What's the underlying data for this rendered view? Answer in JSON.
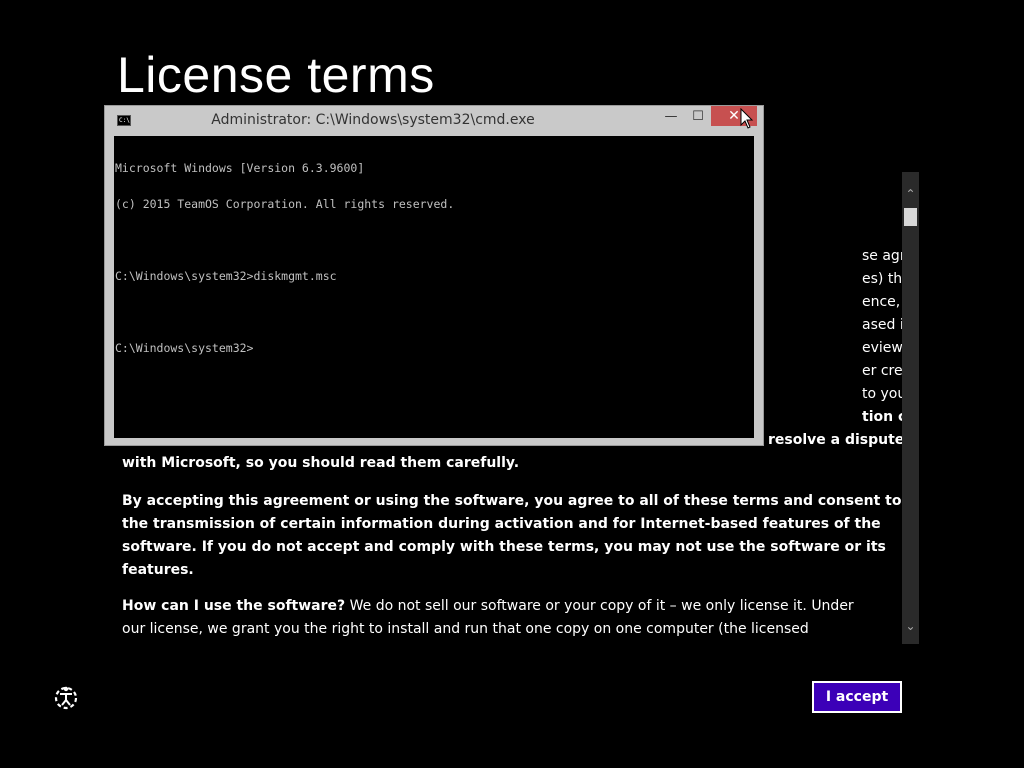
{
  "page": {
    "title": "License terms"
  },
  "license": {
    "partial_lines": [
      "se agreement",
      "es) that describes",
      "ence, we’ve",
      "ased in a question",
      "eview the entire",
      "er create this",
      "to your browser",
      "tion clause and",
      "resolve a dispute"
    ],
    "line_with_microsoft": "with Microsoft, so you should read them carefully.",
    "paragraph_accept": [
      "By accepting this agreement or using the software, you agree to all of these terms and consent to",
      "the transmission of certain information during activation and for Internet-based features of the",
      "software. If you do not accept and comply with these terms, you may not use the software or its",
      "features."
    ],
    "paragraph_use_heading": "How can I use the software?",
    "paragraph_use_line1_rest": " We do not sell our software or your copy of it – we only license it. Under",
    "paragraph_use_line2": "our license, we grant you the right to install and run that one copy on one computer (the licensed"
  },
  "scrollbar": {
    "up_glyph": "⌃",
    "down_glyph": "⌄"
  },
  "accept_button": {
    "label": "I accept"
  },
  "cmd": {
    "title": "Administrator: C:\\Windows\\system32\\cmd.exe",
    "icon_text": "C:\\",
    "minimize_glyph": "—",
    "maximize_glyph": "☐",
    "close_glyph": "✕",
    "lines": [
      "Microsoft Windows [Version 6.3.9600]",
      "(c) 2015 TeamOS Corporation. All rights reserved.",
      "",
      "C:\\Windows\\system32>diskmgmt.msc",
      "",
      "C:\\Windows\\system32>"
    ]
  },
  "icons": {
    "ease_of_access": "ease-of-access-icon",
    "cursor": "mouse-cursor-icon"
  },
  "colors": {
    "background": "#000000",
    "accept_button": "#3c00b8",
    "cmd_close": "#c75050",
    "cmd_frame": "#c9c9c9"
  }
}
